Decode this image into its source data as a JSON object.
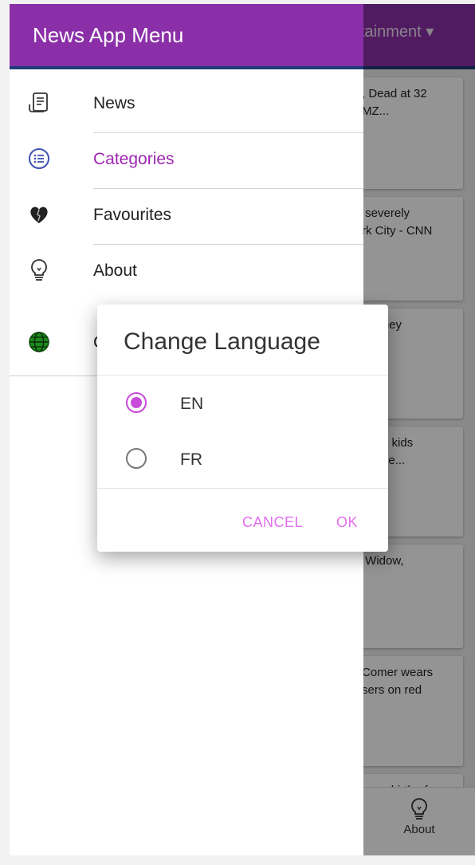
{
  "topbar": {
    "title": "tainment ▾"
  },
  "feed": {
    "cards": [
      ", Dead at 32\nMZ...",
      " severely\nrk City - CNN",
      " Disney",
      " their kids\ney are...",
      " Widow,",
      "Comer wears\nsers on red",
      "unce birth of"
    ]
  },
  "bottom_nav": {
    "about_label": "About"
  },
  "drawer": {
    "title": "News App Menu",
    "items": [
      {
        "label": "News",
        "icon": "newspaper-icon"
      },
      {
        "label": "Categories",
        "icon": "list-circle-icon"
      },
      {
        "label": "Favourites",
        "icon": "heart-icon"
      },
      {
        "label": "About",
        "icon": "lightbulb-icon"
      },
      {
        "label": "C",
        "icon": "globe-icon"
      }
    ]
  },
  "dialog": {
    "title": "Change Language",
    "options": [
      {
        "label": "EN",
        "selected": true
      },
      {
        "label": "FR",
        "selected": false
      }
    ],
    "cancel_label": "CANCEL",
    "ok_label": "OK"
  },
  "colors": {
    "primary": "#8b2fa8",
    "accent": "#c84bd9",
    "active_text": "#9c27b0"
  }
}
